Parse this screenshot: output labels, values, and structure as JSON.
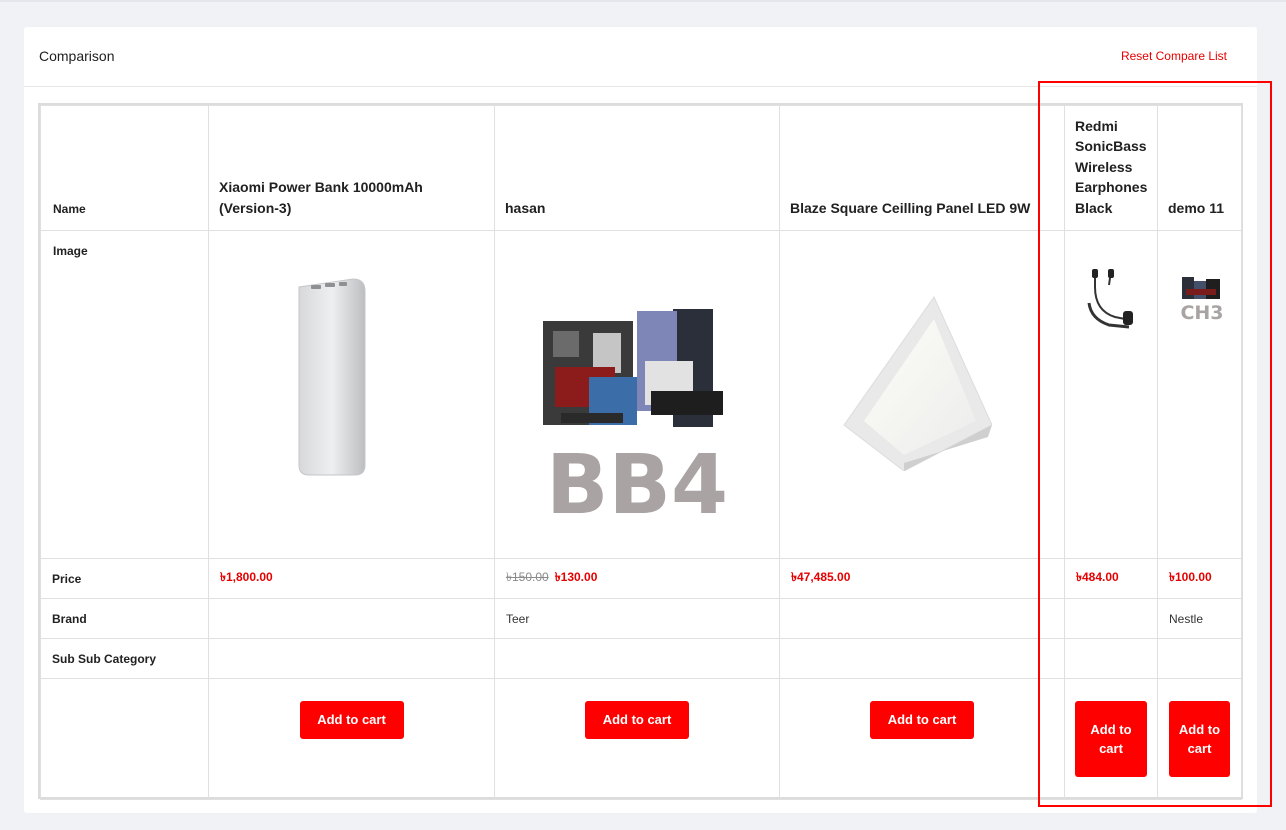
{
  "header": {
    "title": "Comparison",
    "reset_label": "Reset Compare List"
  },
  "rows": {
    "name": "Name",
    "image": "Image",
    "price": "Price",
    "brand": "Brand",
    "sub_sub_category": "Sub Sub Category"
  },
  "products": [
    {
      "name": "Xiaomi Power Bank 10000mAh (Version-3)",
      "price": "৳1,800.00",
      "old_price": "",
      "brand": "",
      "image_icon": "power-bank-image",
      "cart_label": "Add to cart"
    },
    {
      "name": "hasan",
      "price": "৳130.00",
      "old_price": "৳150.00",
      "brand": "Teer",
      "image_icon": "pc-components-image",
      "image_text": "BB4",
      "cart_label": "Add to cart"
    },
    {
      "name": "Blaze Square Ceilling Panel LED 9W",
      "price": "৳47,485.00",
      "old_price": "",
      "brand": "",
      "image_icon": "led-panel-image",
      "cart_label": "Add to cart"
    },
    {
      "name": "Redmi SonicBass Wireless Earphones Black",
      "price": "৳484.00",
      "old_price": "",
      "brand": "",
      "image_icon": "earphones-image",
      "cart_label": "Add to cart"
    },
    {
      "name": "demo 11",
      "price": "৳100.00",
      "old_price": "",
      "brand": "Nestle",
      "image_icon": "pc-components-image",
      "image_text": "CH3",
      "cart_label": "Add to cart"
    }
  ],
  "colors": {
    "accent": "#ff0000",
    "price": "#e60000",
    "background": "#f1f2f6"
  }
}
